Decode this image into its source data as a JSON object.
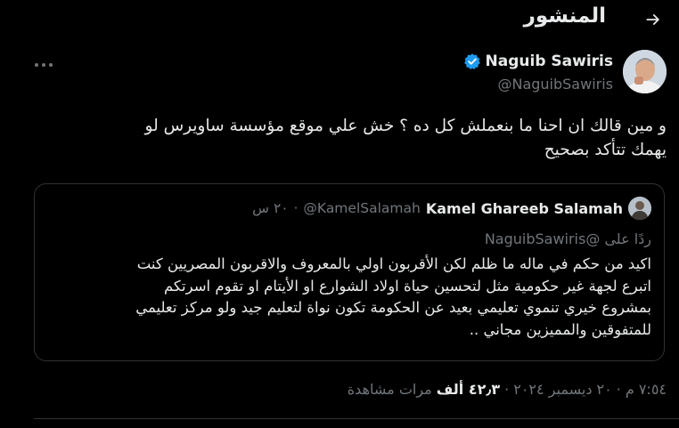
{
  "header": {
    "title": "المنشور",
    "back_icon": "arrow-right-icon"
  },
  "author": {
    "name": "Naguib Sawiris",
    "handle": "@NaguibSawiris",
    "verified": true,
    "verified_color": "#1d9bf0"
  },
  "tweet": {
    "lines": [
      "و مين قالك ان احنا ما بنعملش كل ده ؟ خش علي موقع مؤسسة ساويرس لو",
      "يهمك تتأكد بصحيح"
    ]
  },
  "quote": {
    "name": "Kamel Ghareeb Salamah",
    "handle": "@KamelSalamah",
    "dot": "·",
    "time": "٢٠ س",
    "reply_prefix": "ردًا على",
    "reply_handle": "@NaguibSawiris",
    "lines": [
      "اكيد من حكم في ماله ما ظلم لكن الأقربون اولي بالمعروف  والاقربون المصريين  كنت",
      "اتبرع لجهة غير حكومية  مثل لتحسين حياة اولاد الشوارع او الأيتام او تقوم اسرتكم",
      "بمشروع خيري تنموي تعليمي  بعيد عن  الحكومة تكون نواة  لتعليم جيد ولو مركز تعليمي",
      "للمتفوقين والمميزين  مجاني .."
    ]
  },
  "meta": {
    "time": "٧:٥٤ م",
    "dot1": "·",
    "date": "٢٠ ديسمبر ٢٠٢٤",
    "dot2": "·",
    "views_count": "٤٢٫٣ ألف",
    "views_label": "مرات مشاهدة"
  },
  "colors": {
    "background": "#000000",
    "text": "#e7e9ea",
    "muted": "#71767b",
    "border": "#2f3336"
  }
}
